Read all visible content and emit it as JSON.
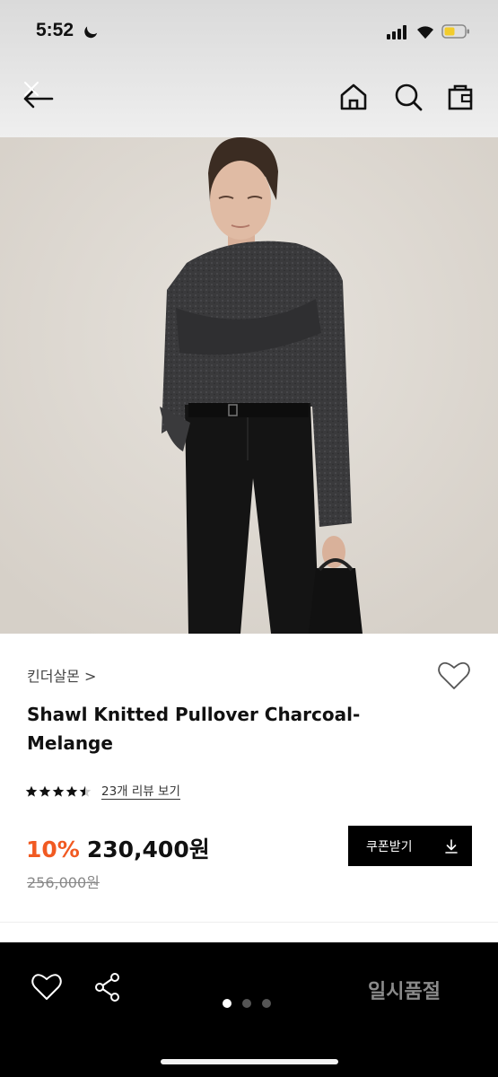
{
  "status_bar": {
    "time": "5:52"
  },
  "product": {
    "brand": "킨더살몬 >",
    "title": "Shawl Knitted Pullover Charcoal-Melange",
    "rating": 4.5,
    "review_link": "23개 리뷰 보기",
    "discount": "10%",
    "price": "230,400원",
    "original_price": "256,000원"
  },
  "actions": {
    "coupon_label": "쿠폰받기",
    "soldout_label": "일시품절"
  },
  "carousel": {
    "total": 3,
    "active": 1
  },
  "colors": {
    "accent": "#f15a22",
    "button_bg": "#000000"
  }
}
